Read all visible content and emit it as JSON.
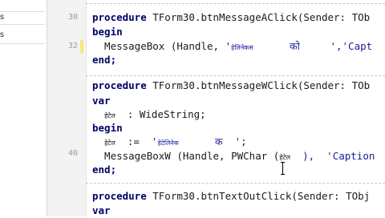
{
  "left_panel": {
    "items": [
      "s",
      "s"
    ]
  },
  "gutter": {
    "numbers": [
      "30",
      "32",
      "40"
    ]
  },
  "code": {
    "l1_kw": "procedure",
    "l1_rest": " TForm30.btnMessageAClick(Sender: TOb",
    "l2": "begin",
    "l3_a": "  MessageBox (Handle, '",
    "l3_b": "हेलिनेकस",
    "l3_c": "      को     ",
    "l3_d": "','Capt",
    "l4": "end;",
    "l5_kw": "procedure",
    "l5_rest": " TForm30.btnMessageWClick(Sender: TOb",
    "l6": "var",
    "l7_a": "  ",
    "l7_b": "हेटेल",
    "l7_c": "  : WideString;",
    "l8": "begin",
    "l9_a": "  ",
    "l9_b": "हेटेल",
    "l9_c": "  :=  '",
    "l9_d": "हेटेलिनेक",
    "l9_e": "      क  ';",
    "l10_a": "  MessageBoxW (Handle, PWChar (",
    "l10_b": "हेटेल",
    "l10_c": "  ),  'Caption",
    "l11": "end;",
    "l12_kw": "procedure",
    "l12_rest": " TForm30.btnTextOutClick(Sender: TObj",
    "l13": "var"
  }
}
